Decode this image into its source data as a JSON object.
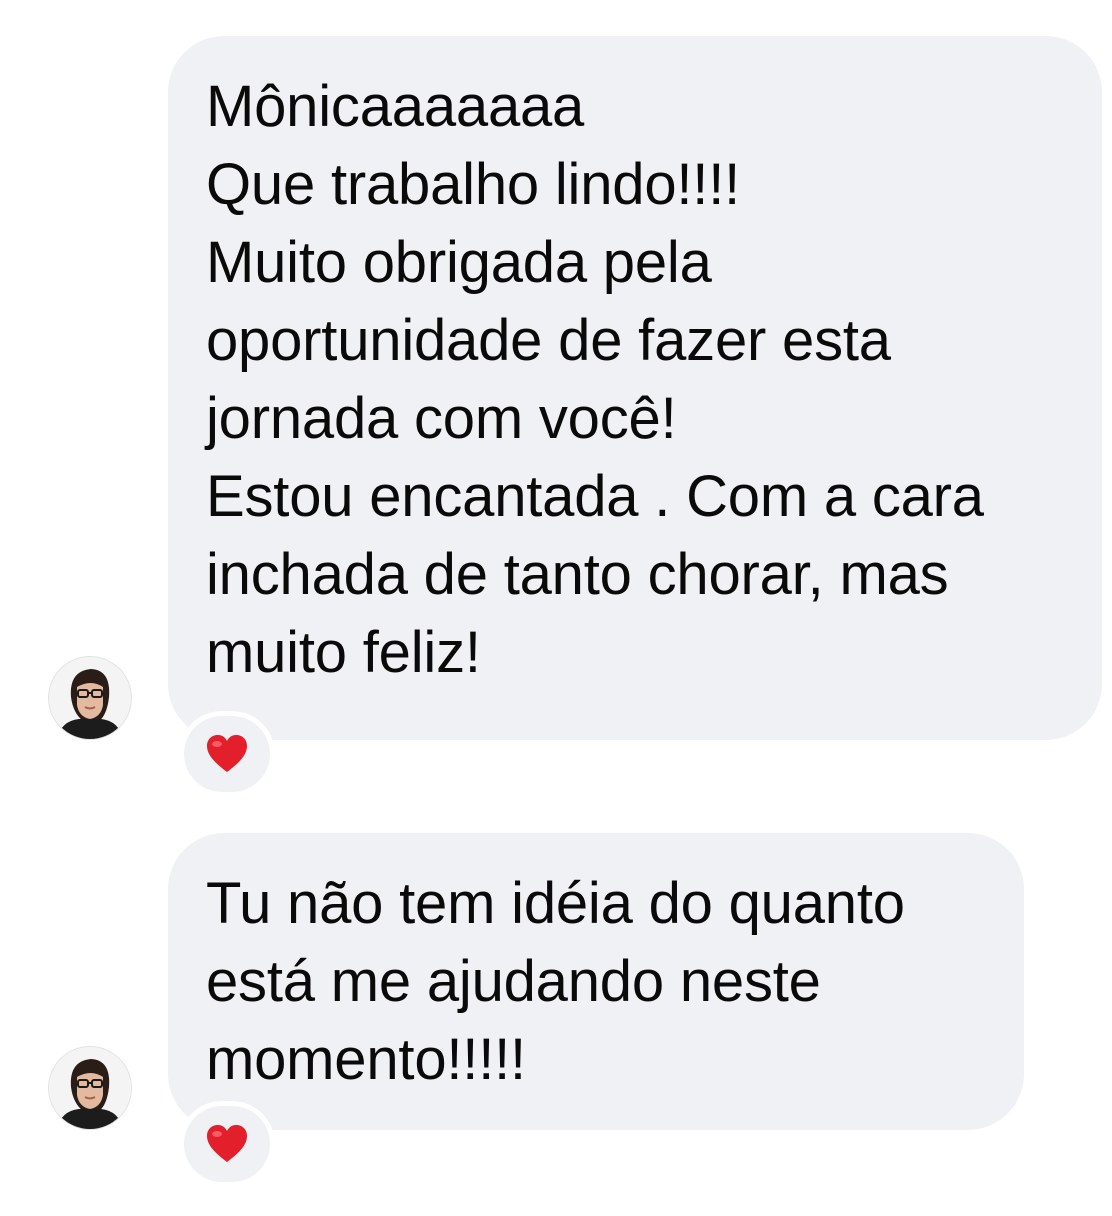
{
  "messages": [
    {
      "lines": [
        "Mônicaaaaaaa",
        "Que trabalho lindo!!!!",
        "Muito obrigada pela",
        "oportunidade de fazer esta",
        "jornada com você!",
        "Estou encantada . Com a cara",
        "inchada de tanto chorar, mas",
        "muito feliz!"
      ],
      "reaction": "heart-icon"
    },
    {
      "lines": [
        "Tu não tem idéia do quanto",
        "está me ajudando neste",
        "momento!!!!!"
      ],
      "reaction": "heart-icon"
    }
  ],
  "colors": {
    "bubble": "#f0f1f4",
    "text": "#0a0a0a",
    "heart": "#e21f2b",
    "background": "#ffffff"
  }
}
